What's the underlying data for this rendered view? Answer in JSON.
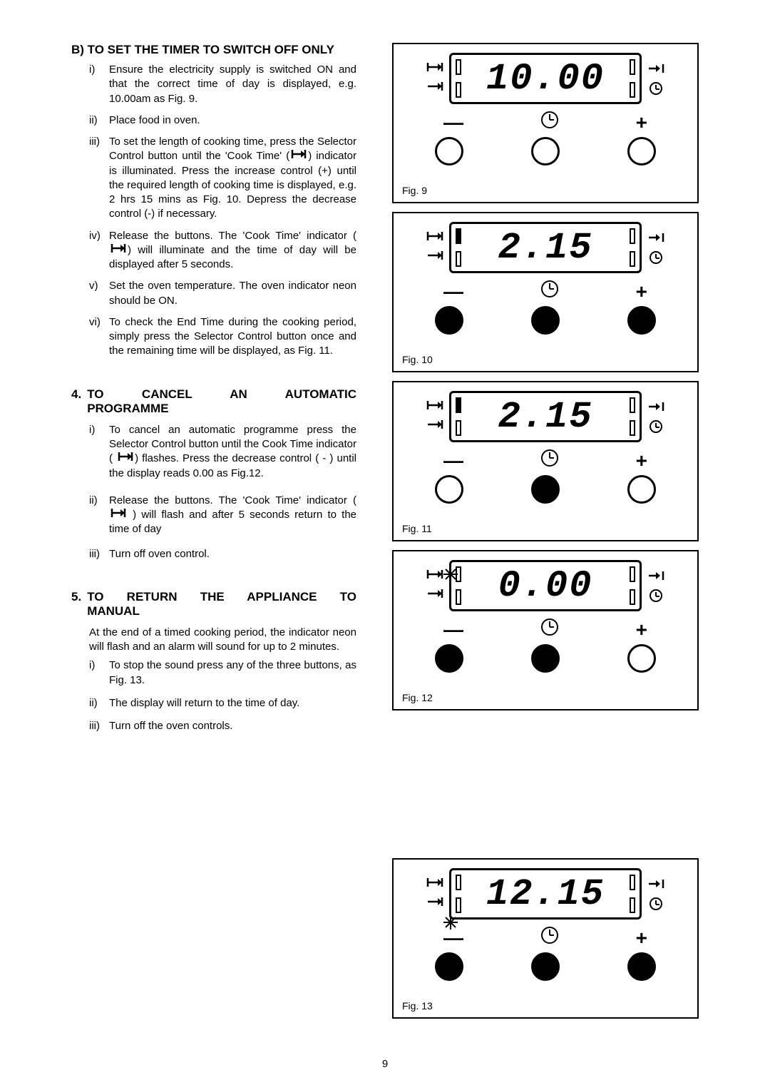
{
  "sectionB": {
    "heading": "B) TO SET THE TIMER TO SWITCH OFF ONLY",
    "items": [
      {
        "roman": "i)",
        "text_before": "Ensure the electricity supply is switched ON and that the correct time of day is displayed, e.g. 10.00am as Fig. 9."
      },
      {
        "roman": "ii)",
        "text_before": "Place food  in oven."
      },
      {
        "roman": "iii)",
        "text_before": "To set the length of cooking  time, press the Selector Control button until the 'Cook Time' (",
        "icon": "cooktime",
        "text_after": ") indicator is illuminated.  Press the  increase control (+) until the required length of cooking time is displayed, e.g. 2 hrs 15 mins as Fig. 10.  Depress the decrease control (-) if necessary."
      },
      {
        "roman": "iv)",
        "text_before": "Release the buttons. The 'Cook Time' indicator ( ",
        "icon": "cooktime",
        "text_after": ") will illuminate and the time of day will be displayed after 5 seconds."
      },
      {
        "roman": "v)",
        "text_before": "Set the oven temperature.  The oven indicator neon should  be ON."
      },
      {
        "roman": "vi)",
        "text_before": "To check the End Time during  the cooking period, simply press the Selector Control button once  and the remaining  time will be displayed, as Fig. 11."
      }
    ]
  },
  "section4": {
    "num": "4.",
    "heading": "TO CANCEL AN AUTOMATIC PROGRAMME",
    "items": [
      {
        "roman": "i)",
        "text_before": "To cancel an  automatic programme press the Selector Control button until the Cook Time indicator ( ",
        "icon": "cooktime",
        "text_after": ") flashes.  Press the decrease control ( - ) until the display reads 0.00 as Fig.12."
      },
      {
        "roman": "ii)",
        "text_before": " Release the buttons.  The 'Cook Time' indicator (  ",
        "icon": "cooktime",
        "text_after": "  ) will flash and after 5 seconds return to the time of day"
      },
      {
        "roman": "iii)",
        "text_before": "Turn off oven control."
      }
    ]
  },
  "section5": {
    "num": "5.",
    "heading": "TO RETURN THE APPLIANCE TO MANUAL",
    "intro": "At the end of a timed cooking period, the indicator neon will flash and an alarm will sound for up to 2 minutes.",
    "items": [
      {
        "roman": "i)",
        "text_before": "To stop the sound press any of the three buttons, as Fig. 13."
      },
      {
        "roman": "ii)",
        "text_before": "The display will return to the time of day."
      },
      {
        "roman": "iii)",
        "text_before": "Turn off the oven controls."
      }
    ]
  },
  "figures": {
    "f9": {
      "label": "Fig. 9",
      "digits": "10.00",
      "tl": "empty",
      "bl": "empty",
      "tr": "empty",
      "br": "empty",
      "b1": "empty",
      "b2": "empty",
      "b3": "empty",
      "star_tl": false,
      "star_bl": false
    },
    "f10": {
      "label": "Fig. 10",
      "digits": "2.15",
      "tl": "filled",
      "bl": "empty",
      "tr": "empty",
      "br": "empty",
      "b1": "filled",
      "b2": "filled",
      "b3": "filled",
      "star_tl": false,
      "star_bl": false
    },
    "f11": {
      "label": "Fig. 11",
      "digits": "2.15",
      "tl": "filled",
      "bl": "empty",
      "tr": "empty",
      "br": "empty",
      "b1": "empty",
      "b2": "filled",
      "b3": "empty",
      "star_tl": false,
      "star_bl": false
    },
    "f12": {
      "label": "Fig. 12",
      "digits": "0.00",
      "tl": "empty",
      "bl": "empty",
      "tr": "empty",
      "br": "empty",
      "b1": "filled",
      "b2": "filled",
      "b3": "empty",
      "star_tl": true,
      "star_bl": false
    },
    "f13": {
      "label": "Fig. 13",
      "digits": "12.15",
      "tl": "empty",
      "bl": "empty",
      "tr": "empty",
      "br": "empty",
      "b1": "filled",
      "b2": "filled",
      "b3": "filled",
      "star_tl": false,
      "star_bl": true
    }
  },
  "symbols": {
    "minus": "—",
    "plus": "+",
    "cooktime_arrow": "⟼",
    "stop_arrow": "→|",
    "cooktime_inline": "⟼"
  },
  "page_number": "9"
}
